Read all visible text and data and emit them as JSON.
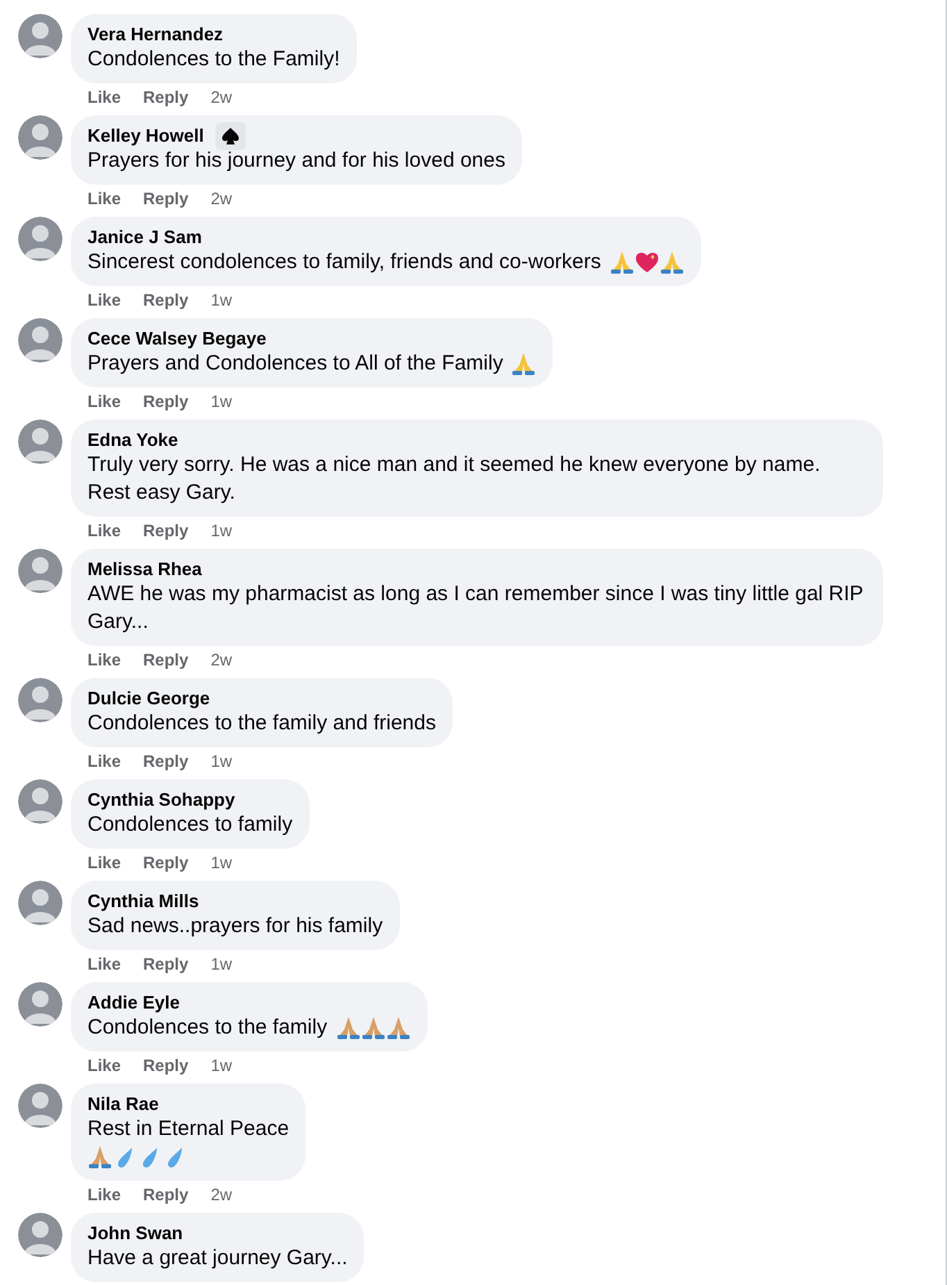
{
  "comments": [
    {
      "author": "Vera Hernandez",
      "badge": false,
      "lines": [
        {
          "text": "Condolences to the Family!"
        }
      ],
      "actions": {
        "like": "Like",
        "reply": "Reply",
        "time": "2w"
      }
    },
    {
      "author": "Kelley Howell",
      "badge": true,
      "lines": [
        {
          "text": "Prayers for his journey and for his loved ones"
        }
      ],
      "actions": {
        "like": "Like",
        "reply": "Reply",
        "time": "2w"
      }
    },
    {
      "author": "Janice J Sam",
      "badge": false,
      "lines": [
        {
          "text": "Sincerest condolences to family, friends and co-workers",
          "emoji": [
            {
              "kind": "pray"
            },
            {
              "kind": "heart"
            },
            {
              "kind": "pray"
            }
          ]
        }
      ],
      "actions": {
        "like": "Like",
        "reply": "Reply",
        "time": "1w"
      }
    },
    {
      "author": "Cece Walsey Begaye",
      "badge": false,
      "lines": [
        {
          "text": "Prayers and Condolences to All of the Family",
          "emoji": [
            {
              "kind": "pray"
            }
          ]
        }
      ],
      "actions": {
        "like": "Like",
        "reply": "Reply",
        "time": "1w"
      }
    },
    {
      "author": "Edna Yoke",
      "badge": false,
      "lines": [
        {
          "text": "Truly very sorry. He was a nice man and it seemed he knew everyone by name. Rest easy Gary."
        }
      ],
      "actions": {
        "like": "Like",
        "reply": "Reply",
        "time": "1w"
      }
    },
    {
      "author": "Melissa Rhea",
      "badge": false,
      "lines": [
        {
          "text": "AWE he was my pharmacist as long as I can remember since I was tiny little gal RIP Gary..."
        }
      ],
      "actions": {
        "like": "Like",
        "reply": "Reply",
        "time": "2w"
      }
    },
    {
      "author": "Dulcie George",
      "badge": false,
      "lines": [
        {
          "text": "Condolences to the family and friends"
        }
      ],
      "actions": {
        "like": "Like",
        "reply": "Reply",
        "time": "1w"
      }
    },
    {
      "author": "Cynthia Sohappy",
      "badge": false,
      "lines": [
        {
          "text": "Condolences to family"
        }
      ],
      "actions": {
        "like": "Like",
        "reply": "Reply",
        "time": "1w"
      }
    },
    {
      "author": "Cynthia Mills",
      "badge": false,
      "lines": [
        {
          "text": "Sad news..prayers for his family"
        }
      ],
      "actions": {
        "like": "Like",
        "reply": "Reply",
        "time": "1w"
      }
    },
    {
      "author": "Addie Eyle",
      "badge": false,
      "lines": [
        {
          "text": "Condolences to the family",
          "emoji": [
            {
              "kind": "pray-tan"
            },
            {
              "kind": "pray-tan"
            },
            {
              "kind": "pray-tan"
            }
          ]
        }
      ],
      "actions": {
        "like": "Like",
        "reply": "Reply",
        "time": "1w"
      }
    },
    {
      "author": "Nila Rae",
      "badge": false,
      "lines": [
        {
          "text": "Rest in Eternal Peace"
        },
        {
          "emoji": [
            {
              "kind": "pray-tan"
            },
            {
              "kind": "drop"
            },
            {
              "kind": "drop"
            },
            {
              "kind": "drop"
            }
          ]
        }
      ],
      "actions": {
        "like": "Like",
        "reply": "Reply",
        "time": "2w"
      }
    },
    {
      "author": "John Swan",
      "badge": false,
      "lines": [
        {
          "text": "Have a great journey Gary..."
        }
      ]
    }
  ]
}
